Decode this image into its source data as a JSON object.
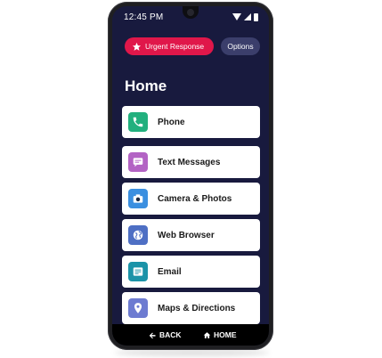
{
  "status_bar": {
    "time": "12:45 PM"
  },
  "header": {
    "urgent_label": "Urgent Response",
    "options_label": "Options",
    "title": "Home"
  },
  "menu": {
    "items": [
      {
        "label": "Phone",
        "icon": "phone-icon",
        "color": "#22b07e"
      },
      {
        "label": "Text Messages",
        "icon": "message-icon",
        "color": "#b363c4"
      },
      {
        "label": "Camera & Photos",
        "icon": "camera-icon",
        "color": "#3b8fe0"
      },
      {
        "label": "Web Browser",
        "icon": "globe-icon",
        "color": "#4e6fc4"
      },
      {
        "label": "Email",
        "icon": "email-icon",
        "color": "#1b93a8"
      },
      {
        "label": "Maps & Directions",
        "icon": "map-pin-icon",
        "color": "#6d7bd1"
      }
    ]
  },
  "nav": {
    "back_label": "BACK",
    "home_label": "HOME"
  },
  "colors": {
    "screen_bg": "#181a3e",
    "urgent": "#e0174a",
    "options": "#3b3e6b"
  }
}
